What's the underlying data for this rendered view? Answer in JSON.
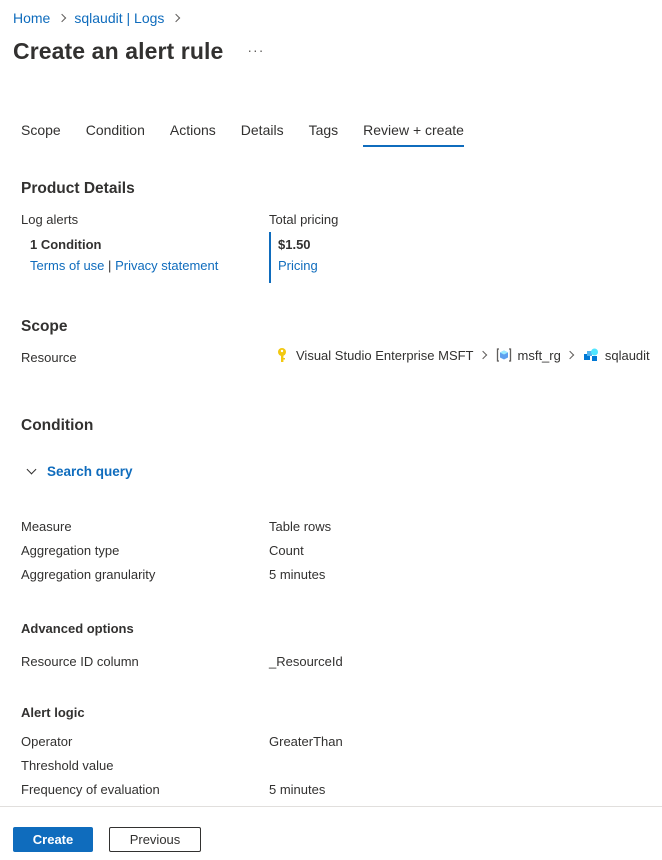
{
  "breadcrumb": {
    "home": "Home",
    "resource": "sqlaudit | Logs"
  },
  "header": {
    "title": "Create an alert rule",
    "more": "···"
  },
  "tabs": [
    {
      "label": "Scope"
    },
    {
      "label": "Condition"
    },
    {
      "label": "Actions"
    },
    {
      "label": "Details"
    },
    {
      "label": "Tags"
    },
    {
      "label": "Review + create",
      "active": true
    }
  ],
  "product_details": {
    "title": "Product Details",
    "log_alerts_label": "Log alerts",
    "condition_count": "1 Condition",
    "terms_link": "Terms of use",
    "separator": "|",
    "privacy_link": "Privacy statement",
    "total_pricing_label": "Total pricing",
    "price": "$1.50",
    "pricing_link": "Pricing"
  },
  "scope": {
    "title": "Scope",
    "resource_label": "Resource",
    "path": [
      {
        "name": "Visual Studio Enterprise MSFT",
        "icon": "subscription-key-icon"
      },
      {
        "name": "msft_rg",
        "icon": "resource-group-icon"
      },
      {
        "name": "sqlaudit",
        "icon": "log-analytics-icon"
      }
    ]
  },
  "condition": {
    "title": "Condition",
    "search_query": "Search query",
    "rows": [
      {
        "label": "Measure",
        "value": "Table rows"
      },
      {
        "label": "Aggregation type",
        "value": "Count"
      },
      {
        "label": "Aggregation granularity",
        "value": "5 minutes"
      }
    ],
    "advanced_title": "Advanced options",
    "advanced_rows": [
      {
        "label": "Resource ID column",
        "value": "_ResourceId"
      }
    ],
    "logic_title": "Alert logic",
    "logic_rows": [
      {
        "label": "Operator",
        "value": "GreaterThan"
      },
      {
        "label": "Threshold value",
        "value": ""
      },
      {
        "label": "Frequency of evaluation",
        "value": "5 minutes"
      }
    ]
  },
  "footer": {
    "create": "Create",
    "previous": "Previous"
  },
  "colors": {
    "accent": "#0f6cbd",
    "text": "#323130"
  }
}
